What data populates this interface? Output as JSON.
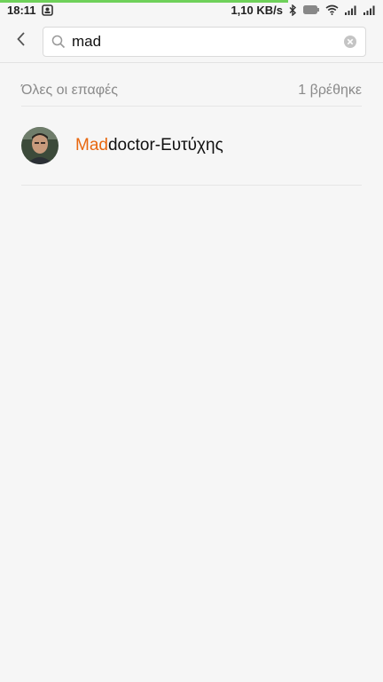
{
  "status_bar": {
    "time": "18:11",
    "speed": "1,10 KB/s",
    "icons": [
      "notification-icon",
      "bluetooth-icon",
      "battery-icon",
      "wifi-icon",
      "signal-icon",
      "signal-icon-2"
    ]
  },
  "search": {
    "query": "mad",
    "back_icon": "chevron-left-icon",
    "search_icon": "search-icon",
    "clear_icon": "clear-icon"
  },
  "section": {
    "title": "Όλες οι επαφές",
    "count": "1 βρέθηκε"
  },
  "contacts": [
    {
      "match": "Mad",
      "rest": "doctor-Ευτύχης"
    }
  ],
  "colors": {
    "accent": "#e8670f",
    "progress": "#6fd15a",
    "background": "#f6f6f6"
  }
}
